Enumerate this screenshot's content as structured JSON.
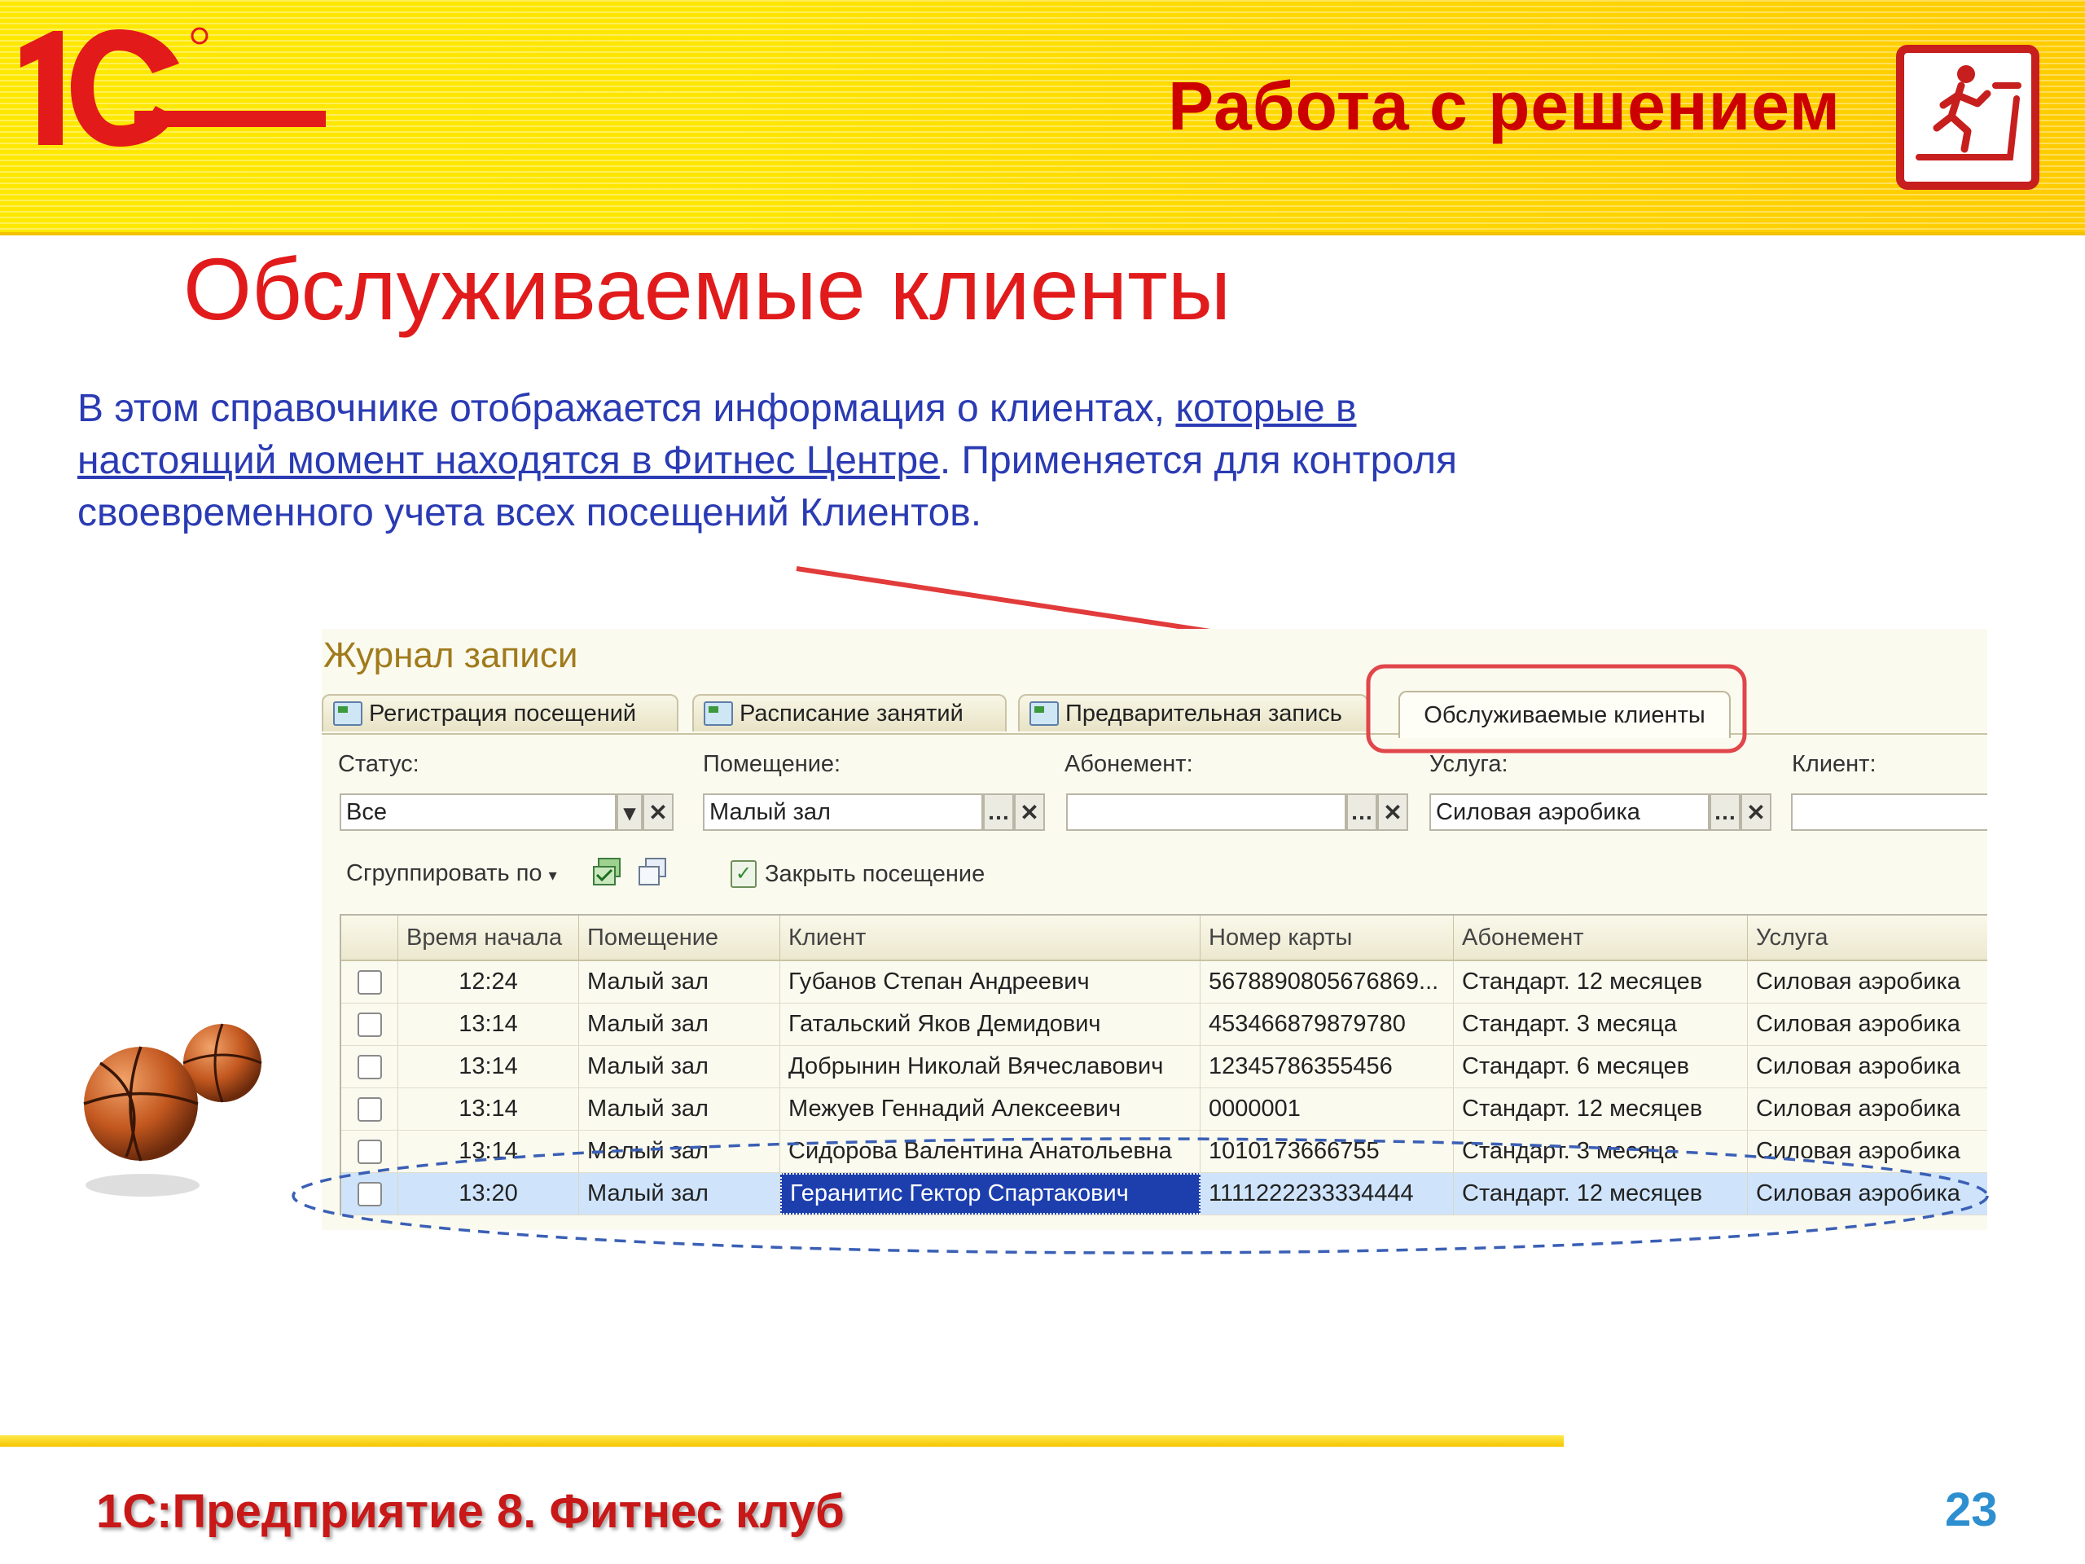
{
  "header": {
    "logo_text": "1C",
    "title": "Работа с решением"
  },
  "page_title": "Обслуживаемые клиенты",
  "description": {
    "part1": "В этом справочнике отображается информация о клиентах, ",
    "underlined": "которые в настоящий момент находятся в Фитнес Центре",
    "part2": ". Применяется для контроля своевременного учета всех посещений Клиентов."
  },
  "app": {
    "window_title": "Журнал записи",
    "tabs": [
      {
        "label": "Регистрация посещений"
      },
      {
        "label": "Расписание занятий"
      },
      {
        "label": "Предварительная запись"
      },
      {
        "label": "Обслуживаемые клиенты",
        "active": true
      }
    ],
    "filters": {
      "status": {
        "label": "Статус:",
        "value": "Все"
      },
      "room": {
        "label": "Помещение:",
        "value": "Малый зал"
      },
      "subscription": {
        "label": "Абонемент:",
        "value": ""
      },
      "service": {
        "label": "Услуга:",
        "value": "Силовая аэробика"
      },
      "client": {
        "label": "Клиент:",
        "value": ""
      }
    },
    "toolbar": {
      "group_by": "Сгруппировать по",
      "close_visit": "Закрыть посещение"
    },
    "columns": [
      "Время начала",
      "Помещение",
      "Клиент",
      "Номер карты",
      "Абонемент",
      "Услуга"
    ],
    "rows": [
      {
        "time": "12:24",
        "room": "Малый зал",
        "client": "Губанов Степан Андреевич",
        "card": "5678890805676869...",
        "subscription": "Стандарт. 12 месяцев",
        "service": "Силовая аэробика"
      },
      {
        "time": "13:14",
        "room": "Малый зал",
        "client": "Гатальский Яков Демидович",
        "card": "453466879879780",
        "subscription": "Стандарт. 3 месяца",
        "service": "Силовая аэробика"
      },
      {
        "time": "13:14",
        "room": "Малый зал",
        "client": "Добрынин Николай Вячеславович",
        "card": "12345786355456",
        "subscription": "Стандарт. 6 месяцев",
        "service": "Силовая аэробика"
      },
      {
        "time": "13:14",
        "room": "Малый зал",
        "client": "Межуев Геннадий Алексеевич",
        "card": "0000001",
        "subscription": "Стандарт. 12 месяцев",
        "service": "Силовая аэробика"
      },
      {
        "time": "13:14",
        "room": "Малый зал",
        "client": "Сидорова Валентина Анатольевна",
        "card": "1010173666755",
        "subscription": "Стандарт. 3 месяца",
        "service": "Силовая аэробика"
      },
      {
        "time": "13:20",
        "room": "Малый зал",
        "client": "Геранитис Гектор Спартакович",
        "card": "1111222233334444",
        "subscription": "Стандарт. 12 месяцев",
        "service": "Силовая аэробика",
        "selected": true
      }
    ]
  },
  "footer": {
    "title": "1С:Предприятие 8. Фитнес клуб",
    "page_number": "23"
  },
  "colors": {
    "accent_red": "#e11b1b",
    "header_yellow": "#ffe600",
    "text_blue": "#2a3bb3",
    "selection_blue": "#1d3fae"
  }
}
